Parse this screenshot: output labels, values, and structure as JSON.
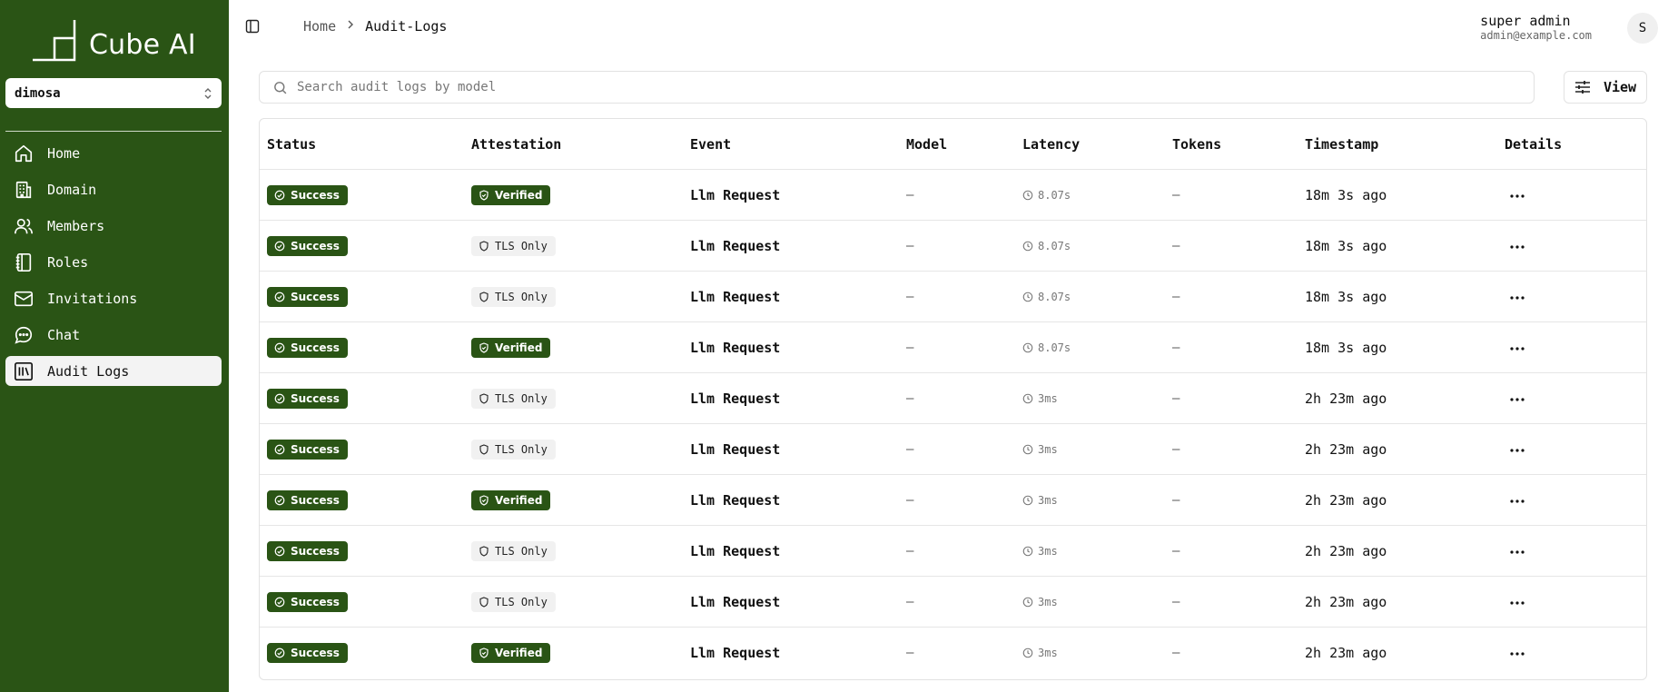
{
  "app": {
    "name": "Cube AI"
  },
  "workspace": {
    "selected": "dimosa"
  },
  "sidebar": {
    "items": [
      {
        "label": "Home",
        "icon": "home-icon"
      },
      {
        "label": "Domain",
        "icon": "building-icon"
      },
      {
        "label": "Members",
        "icon": "users-icon"
      },
      {
        "label": "Roles",
        "icon": "notebook-icon"
      },
      {
        "label": "Invitations",
        "icon": "mail-icon"
      },
      {
        "label": "Chat",
        "icon": "chat-icon"
      },
      {
        "label": "Audit Logs",
        "icon": "library-icon",
        "active": true
      }
    ]
  },
  "breadcrumb": {
    "home": "Home",
    "current": "Audit-Logs"
  },
  "user": {
    "name": "super admin",
    "email": "admin@example.com",
    "initial": "S"
  },
  "search": {
    "placeholder": "Search audit logs by model",
    "value": ""
  },
  "view_button": {
    "label": "View"
  },
  "table": {
    "headers": [
      "Status",
      "Attestation",
      "Event",
      "Model",
      "Latency",
      "Tokens",
      "Timestamp",
      "Details"
    ],
    "rows": [
      {
        "status": "Success",
        "attestation": "Verified",
        "event": "Llm Request",
        "model": "—",
        "latency": "8.07s",
        "tokens": "—",
        "timestamp": "18m 3s ago"
      },
      {
        "status": "Success",
        "attestation": "TLS Only",
        "event": "Llm Request",
        "model": "—",
        "latency": "8.07s",
        "tokens": "—",
        "timestamp": "18m 3s ago"
      },
      {
        "status": "Success",
        "attestation": "TLS Only",
        "event": "Llm Request",
        "model": "—",
        "latency": "8.07s",
        "tokens": "—",
        "timestamp": "18m 3s ago"
      },
      {
        "status": "Success",
        "attestation": "Verified",
        "event": "Llm Request",
        "model": "—",
        "latency": "8.07s",
        "tokens": "—",
        "timestamp": "18m 3s ago"
      },
      {
        "status": "Success",
        "attestation": "TLS Only",
        "event": "Llm Request",
        "model": "—",
        "latency": "3ms",
        "tokens": "—",
        "timestamp": "2h 23m ago"
      },
      {
        "status": "Success",
        "attestation": "TLS Only",
        "event": "Llm Request",
        "model": "—",
        "latency": "3ms",
        "tokens": "—",
        "timestamp": "2h 23m ago"
      },
      {
        "status": "Success",
        "attestation": "Verified",
        "event": "Llm Request",
        "model": "—",
        "latency": "3ms",
        "tokens": "—",
        "timestamp": "2h 23m ago"
      },
      {
        "status": "Success",
        "attestation": "TLS Only",
        "event": "Llm Request",
        "model": "—",
        "latency": "3ms",
        "tokens": "—",
        "timestamp": "2h 23m ago"
      },
      {
        "status": "Success",
        "attestation": "TLS Only",
        "event": "Llm Request",
        "model": "—",
        "latency": "3ms",
        "tokens": "—",
        "timestamp": "2h 23m ago"
      },
      {
        "status": "Success",
        "attestation": "Verified",
        "event": "Llm Request",
        "model": "—",
        "latency": "3ms",
        "tokens": "—",
        "timestamp": "2h 23m ago"
      }
    ]
  },
  "colors": {
    "brand": "#2a5415",
    "active_nav_bg": "#f3f3f3",
    "border": "#e2e2e2"
  }
}
